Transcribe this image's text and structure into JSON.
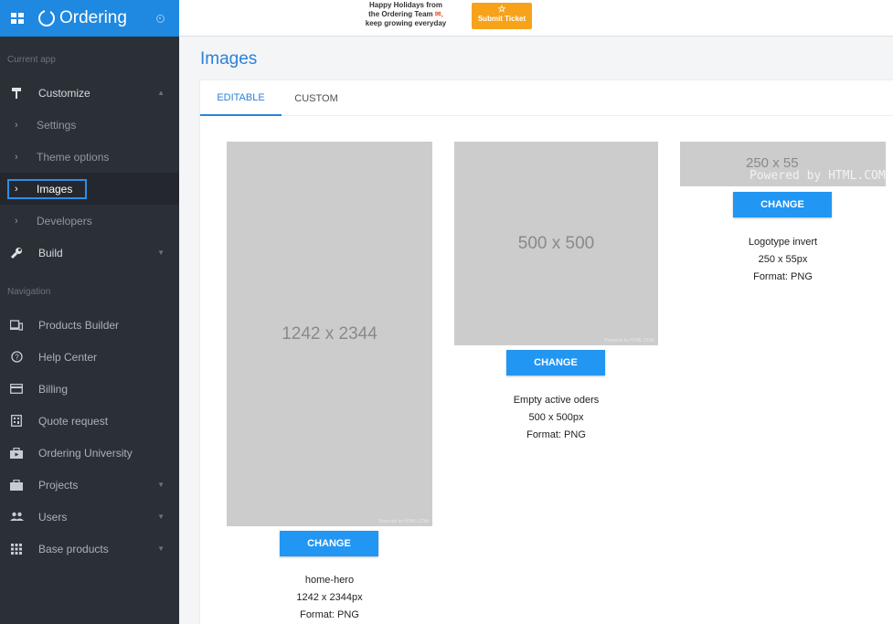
{
  "app": {
    "name": "Ordering"
  },
  "topbar": {
    "holiday_line1": "Happy Holidays from",
    "holiday_line2": "the Ordering Team",
    "holiday_line3": "keep growing everyday",
    "submit_ticket": "Submit Ticket"
  },
  "sidebar": {
    "section_current": "Current app",
    "customize": "Customize",
    "sub_items": [
      "Settings",
      "Theme options",
      "Images",
      "Developers"
    ],
    "build": "Build",
    "section_navigation": "Navigation",
    "nav_items": [
      "Products Builder",
      "Help Center",
      "Billing",
      "Quote request",
      "Ordering University",
      "Projects",
      "Users",
      "Base products"
    ]
  },
  "main": {
    "title": "Images",
    "tabs": [
      "EDITABLE",
      "CUSTOM"
    ],
    "images": [
      {
        "placeholder": "1242 x 2344",
        "button": "CHANGE",
        "name": "home-hero",
        "size": "1242 x 2344px",
        "format": "Format: PNG",
        "powered": "Powered by HTML.COM"
      },
      {
        "placeholder": "500 x 500",
        "button": "CHANGE",
        "name": "Empty active oders",
        "size": "500 x 500px",
        "format": "Format: PNG",
        "powered": "Powered by HTML.COM"
      },
      {
        "placeholder": "250 x 55",
        "button": "CHANGE",
        "name": "Logotype invert",
        "size": "250 x 55px",
        "format": "Format: PNG",
        "powered": "Powered by HTML.COM"
      }
    ]
  },
  "colors": {
    "accent": "#2196f3",
    "sidebar": "#2b3037",
    "title": "#2a82d9",
    "ticket": "#f7a21b"
  }
}
